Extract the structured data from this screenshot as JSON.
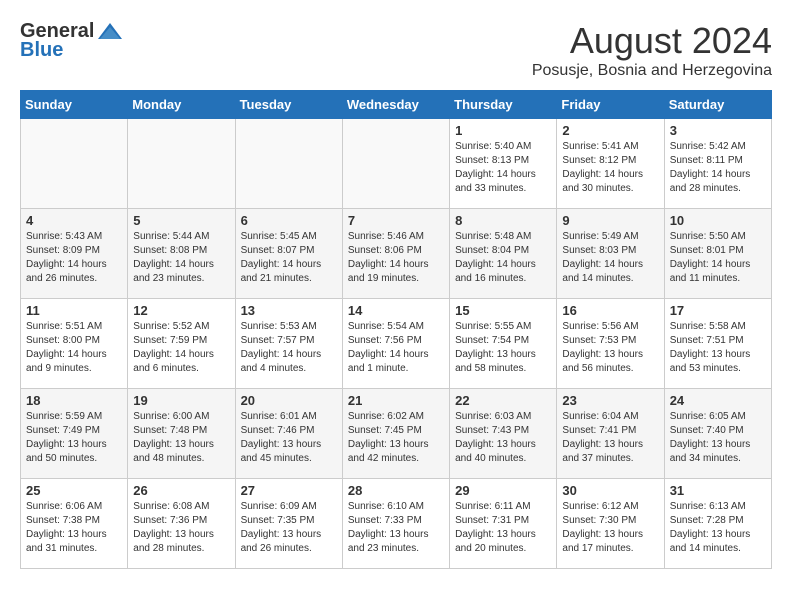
{
  "header": {
    "logo_general": "General",
    "logo_blue": "Blue",
    "month": "August 2024",
    "location": "Posusje, Bosnia and Herzegovina"
  },
  "days_of_week": [
    "Sunday",
    "Monday",
    "Tuesday",
    "Wednesday",
    "Thursday",
    "Friday",
    "Saturday"
  ],
  "weeks": [
    [
      {
        "day": "",
        "info": ""
      },
      {
        "day": "",
        "info": ""
      },
      {
        "day": "",
        "info": ""
      },
      {
        "day": "",
        "info": ""
      },
      {
        "day": "1",
        "info": "Sunrise: 5:40 AM\nSunset: 8:13 PM\nDaylight: 14 hours\nand 33 minutes."
      },
      {
        "day": "2",
        "info": "Sunrise: 5:41 AM\nSunset: 8:12 PM\nDaylight: 14 hours\nand 30 minutes."
      },
      {
        "day": "3",
        "info": "Sunrise: 5:42 AM\nSunset: 8:11 PM\nDaylight: 14 hours\nand 28 minutes."
      }
    ],
    [
      {
        "day": "4",
        "info": "Sunrise: 5:43 AM\nSunset: 8:09 PM\nDaylight: 14 hours\nand 26 minutes."
      },
      {
        "day": "5",
        "info": "Sunrise: 5:44 AM\nSunset: 8:08 PM\nDaylight: 14 hours\nand 23 minutes."
      },
      {
        "day": "6",
        "info": "Sunrise: 5:45 AM\nSunset: 8:07 PM\nDaylight: 14 hours\nand 21 minutes."
      },
      {
        "day": "7",
        "info": "Sunrise: 5:46 AM\nSunset: 8:06 PM\nDaylight: 14 hours\nand 19 minutes."
      },
      {
        "day": "8",
        "info": "Sunrise: 5:48 AM\nSunset: 8:04 PM\nDaylight: 14 hours\nand 16 minutes."
      },
      {
        "day": "9",
        "info": "Sunrise: 5:49 AM\nSunset: 8:03 PM\nDaylight: 14 hours\nand 14 minutes."
      },
      {
        "day": "10",
        "info": "Sunrise: 5:50 AM\nSunset: 8:01 PM\nDaylight: 14 hours\nand 11 minutes."
      }
    ],
    [
      {
        "day": "11",
        "info": "Sunrise: 5:51 AM\nSunset: 8:00 PM\nDaylight: 14 hours\nand 9 minutes."
      },
      {
        "day": "12",
        "info": "Sunrise: 5:52 AM\nSunset: 7:59 PM\nDaylight: 14 hours\nand 6 minutes."
      },
      {
        "day": "13",
        "info": "Sunrise: 5:53 AM\nSunset: 7:57 PM\nDaylight: 14 hours\nand 4 minutes."
      },
      {
        "day": "14",
        "info": "Sunrise: 5:54 AM\nSunset: 7:56 PM\nDaylight: 14 hours\nand 1 minute."
      },
      {
        "day": "15",
        "info": "Sunrise: 5:55 AM\nSunset: 7:54 PM\nDaylight: 13 hours\nand 58 minutes."
      },
      {
        "day": "16",
        "info": "Sunrise: 5:56 AM\nSunset: 7:53 PM\nDaylight: 13 hours\nand 56 minutes."
      },
      {
        "day": "17",
        "info": "Sunrise: 5:58 AM\nSunset: 7:51 PM\nDaylight: 13 hours\nand 53 minutes."
      }
    ],
    [
      {
        "day": "18",
        "info": "Sunrise: 5:59 AM\nSunset: 7:49 PM\nDaylight: 13 hours\nand 50 minutes."
      },
      {
        "day": "19",
        "info": "Sunrise: 6:00 AM\nSunset: 7:48 PM\nDaylight: 13 hours\nand 48 minutes."
      },
      {
        "day": "20",
        "info": "Sunrise: 6:01 AM\nSunset: 7:46 PM\nDaylight: 13 hours\nand 45 minutes."
      },
      {
        "day": "21",
        "info": "Sunrise: 6:02 AM\nSunset: 7:45 PM\nDaylight: 13 hours\nand 42 minutes."
      },
      {
        "day": "22",
        "info": "Sunrise: 6:03 AM\nSunset: 7:43 PM\nDaylight: 13 hours\nand 40 minutes."
      },
      {
        "day": "23",
        "info": "Sunrise: 6:04 AM\nSunset: 7:41 PM\nDaylight: 13 hours\nand 37 minutes."
      },
      {
        "day": "24",
        "info": "Sunrise: 6:05 AM\nSunset: 7:40 PM\nDaylight: 13 hours\nand 34 minutes."
      }
    ],
    [
      {
        "day": "25",
        "info": "Sunrise: 6:06 AM\nSunset: 7:38 PM\nDaylight: 13 hours\nand 31 minutes."
      },
      {
        "day": "26",
        "info": "Sunrise: 6:08 AM\nSunset: 7:36 PM\nDaylight: 13 hours\nand 28 minutes."
      },
      {
        "day": "27",
        "info": "Sunrise: 6:09 AM\nSunset: 7:35 PM\nDaylight: 13 hours\nand 26 minutes."
      },
      {
        "day": "28",
        "info": "Sunrise: 6:10 AM\nSunset: 7:33 PM\nDaylight: 13 hours\nand 23 minutes."
      },
      {
        "day": "29",
        "info": "Sunrise: 6:11 AM\nSunset: 7:31 PM\nDaylight: 13 hours\nand 20 minutes."
      },
      {
        "day": "30",
        "info": "Sunrise: 6:12 AM\nSunset: 7:30 PM\nDaylight: 13 hours\nand 17 minutes."
      },
      {
        "day": "31",
        "info": "Sunrise: 6:13 AM\nSunset: 7:28 PM\nDaylight: 13 hours\nand 14 minutes."
      }
    ]
  ]
}
